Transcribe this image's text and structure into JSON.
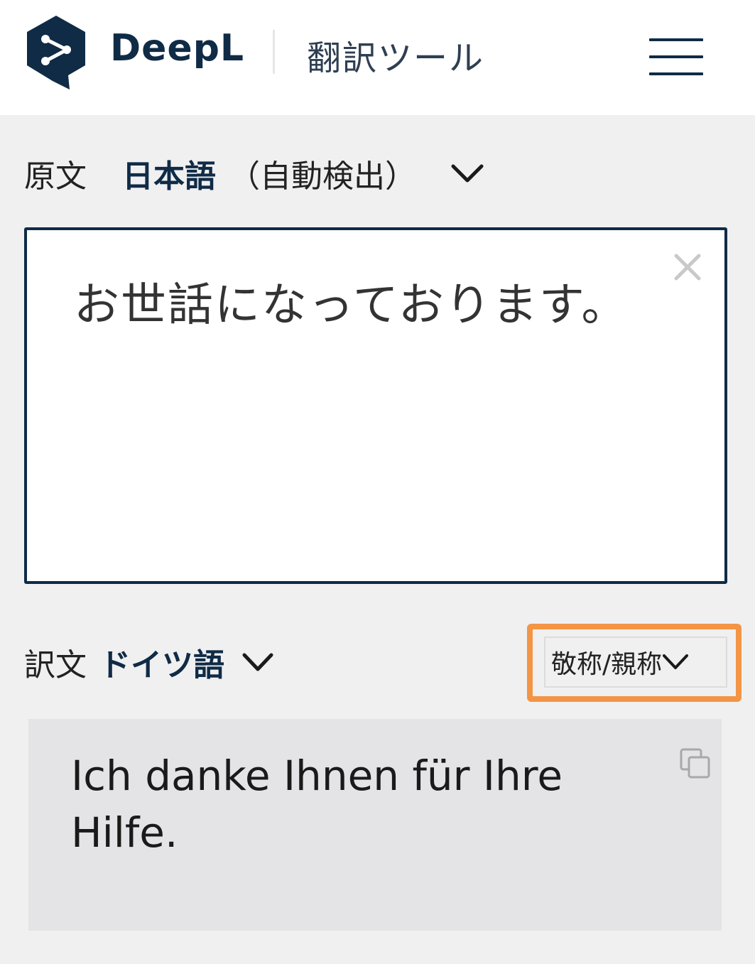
{
  "header": {
    "brand": "DeepL",
    "tool_label": "翻訳ツール",
    "logo_icon": "deepl-share-logo-icon",
    "menu_icon": "hamburger-menu-icon"
  },
  "source": {
    "label": "原文",
    "language": "日本語",
    "detect_note": "（自動検出）",
    "text": "お世話になっております。",
    "clear_icon": "close-icon"
  },
  "target": {
    "label": "訳文",
    "language": "ドイツ語",
    "formality_label": "敬称/親称",
    "text": "Ich danke Ihnen für Ihre Hilfe.",
    "copy_icon": "copy-icon"
  },
  "colors": {
    "brand_navy": "#0f2b46",
    "highlight_orange": "#f39545",
    "page_background": "#f0f0f1",
    "target_background": "#e4e4e6"
  }
}
